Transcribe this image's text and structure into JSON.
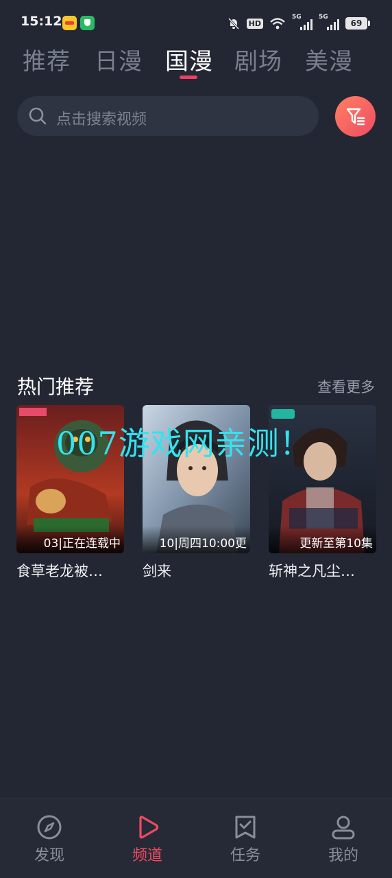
{
  "status_bar": {
    "time": "15:12",
    "hd_label": "HD",
    "network_1": "5G",
    "network_2": "5G",
    "battery": "69"
  },
  "top_tabs": [
    {
      "label": "推荐",
      "active": false
    },
    {
      "label": "日漫",
      "active": false
    },
    {
      "label": "国漫",
      "active": true
    },
    {
      "label": "剧场",
      "active": false
    },
    {
      "label": "美漫",
      "active": false
    }
  ],
  "search": {
    "placeholder": "点击搜索视频",
    "icon": "search-icon"
  },
  "filter_button": {
    "icon": "filter-icon"
  },
  "hot_section": {
    "title": "热门推荐",
    "more_label": "查看更多",
    "items": [
      {
        "title": "食草老龙被…",
        "episode": "03|正在连载中"
      },
      {
        "title": "剑来",
        "episode": "10|周四10:00更"
      },
      {
        "title": "斩神之凡尘…",
        "episode": "更新至第10集"
      }
    ]
  },
  "watermark": "007游戏网亲测！",
  "bottom_nav": [
    {
      "label": "发现",
      "icon": "compass-icon",
      "active": false
    },
    {
      "label": "频道",
      "icon": "play-icon",
      "active": true
    },
    {
      "label": "任务",
      "icon": "task-icon",
      "active": false
    },
    {
      "label": "我的",
      "icon": "user-icon",
      "active": false
    }
  ],
  "colors": {
    "background": "#232733",
    "accent": "#f04a64",
    "watermark": "#33e3ee"
  }
}
